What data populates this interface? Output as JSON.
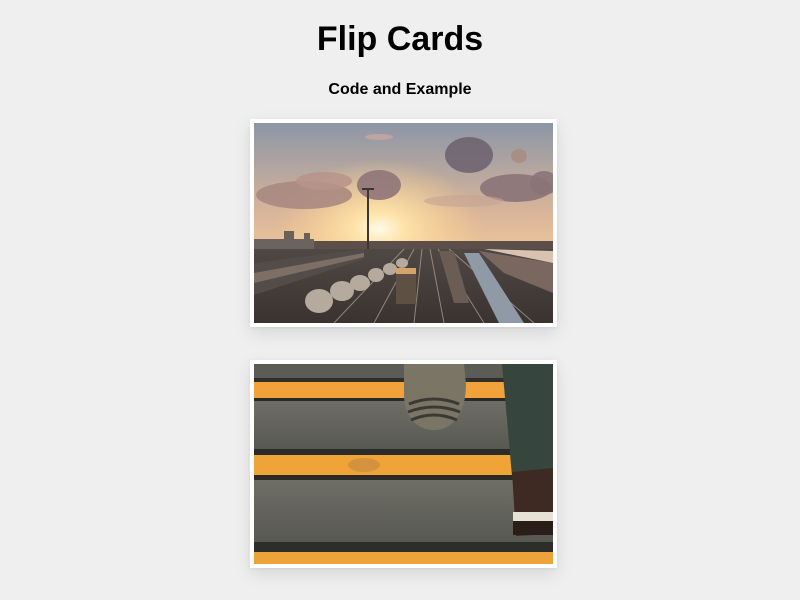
{
  "header": {
    "title": "Flip Cards",
    "subtitle": "Code and Example"
  },
  "cards": [
    {
      "name": "rail-yard-sunset",
      "accent": "#f7b85a"
    },
    {
      "name": "stairs-yellow-stripes",
      "accent": "#f5a623"
    }
  ]
}
